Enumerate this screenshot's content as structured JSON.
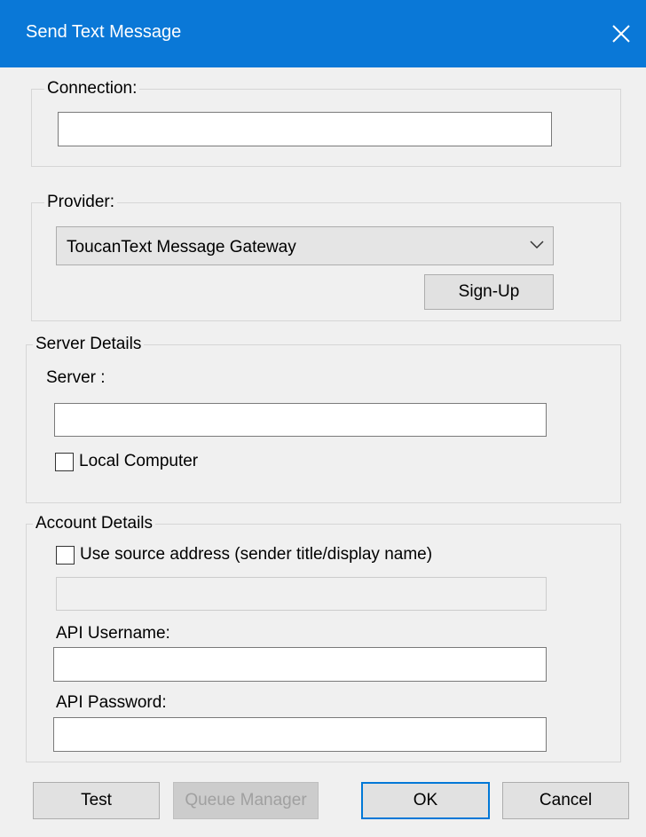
{
  "window": {
    "title": "Send Text Message"
  },
  "connection": {
    "label": "Connection:",
    "value": ""
  },
  "provider": {
    "label": "Provider:",
    "selected": "ToucanText Message Gateway",
    "signup_label": "Sign-Up"
  },
  "server_details": {
    "legend": "Server Details",
    "server_label": "Server :",
    "server_value": "",
    "local_computer_label": "Local Computer",
    "local_computer_checked": false
  },
  "account_details": {
    "legend": "Account Details",
    "use_source_label": "Use source address (sender title/display name)",
    "use_source_checked": false,
    "source_value": "",
    "api_username_label": "API Username:",
    "api_username_value": "",
    "api_password_label": "API Password:",
    "api_password_value": ""
  },
  "buttons": {
    "test": "Test",
    "queue_manager": "Queue Manager",
    "ok": "OK",
    "cancel": "Cancel"
  }
}
